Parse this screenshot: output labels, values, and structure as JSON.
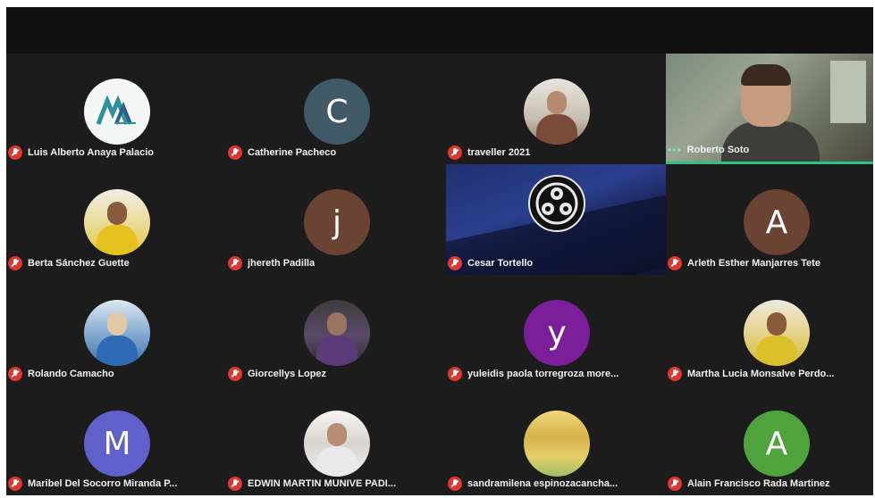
{
  "meeting": {
    "participants": [
      {
        "id": "p1",
        "name": "Luis Alberto Anaya Palacio",
        "avatar_type": "logo",
        "avatar_text": "M",
        "muted": true
      },
      {
        "id": "p2",
        "name": "Catherine Pacheco",
        "avatar_type": "letter",
        "avatar_text": "C",
        "muted": true
      },
      {
        "id": "p3",
        "name": "traveller 2021",
        "avatar_type": "photo",
        "avatar_text": "",
        "muted": true
      },
      {
        "id": "p4",
        "name": "Roberto Soto",
        "avatar_type": "video",
        "avatar_text": "",
        "muted": false,
        "active_speaker": true
      },
      {
        "id": "p5",
        "name": "Berta Sánchez Guette",
        "avatar_type": "photo",
        "avatar_text": "",
        "muted": true
      },
      {
        "id": "p6",
        "name": "jhereth Padilla",
        "avatar_type": "letter",
        "avatar_text": "j",
        "muted": true
      },
      {
        "id": "p7",
        "name": "Cesar Tortello",
        "avatar_type": "screen",
        "avatar_text": "",
        "muted": true
      },
      {
        "id": "p8",
        "name": "Arleth Esther Manjarres Tete",
        "avatar_type": "letter",
        "avatar_text": "A",
        "muted": true
      },
      {
        "id": "p9",
        "name": "Rolando Camacho",
        "avatar_type": "photo",
        "avatar_text": "",
        "muted": true
      },
      {
        "id": "p10",
        "name": "Giorcellys Lopez",
        "avatar_type": "photo",
        "avatar_text": "",
        "muted": true
      },
      {
        "id": "p11",
        "name": "yuleidis paola torregroza more...",
        "avatar_type": "letter",
        "avatar_text": "y",
        "muted": true
      },
      {
        "id": "p12",
        "name": "Martha Lucia Monsalve Perdo...",
        "avatar_type": "photo",
        "avatar_text": "",
        "muted": true
      },
      {
        "id": "p13",
        "name": "Maribel Del Socorro Miranda P...",
        "avatar_type": "letter",
        "avatar_text": "M",
        "muted": true
      },
      {
        "id": "p14",
        "name": "EDWIN MARTIN MUNIVE PADI...",
        "avatar_type": "photo",
        "avatar_text": "",
        "muted": true
      },
      {
        "id": "p15",
        "name": "sandramilena espinozacancha...",
        "avatar_type": "photo",
        "avatar_text": "",
        "muted": true
      },
      {
        "id": "p16",
        "name": "Alain Francisco Rada Martinez",
        "avatar_type": "letter",
        "avatar_text": "A",
        "muted": true
      }
    ],
    "active_indicator": "•••",
    "colors": {
      "muted_mic": "#e0362f",
      "active_speaker_border": "#2ec27e",
      "tile_background": "#1c1c1c"
    }
  }
}
